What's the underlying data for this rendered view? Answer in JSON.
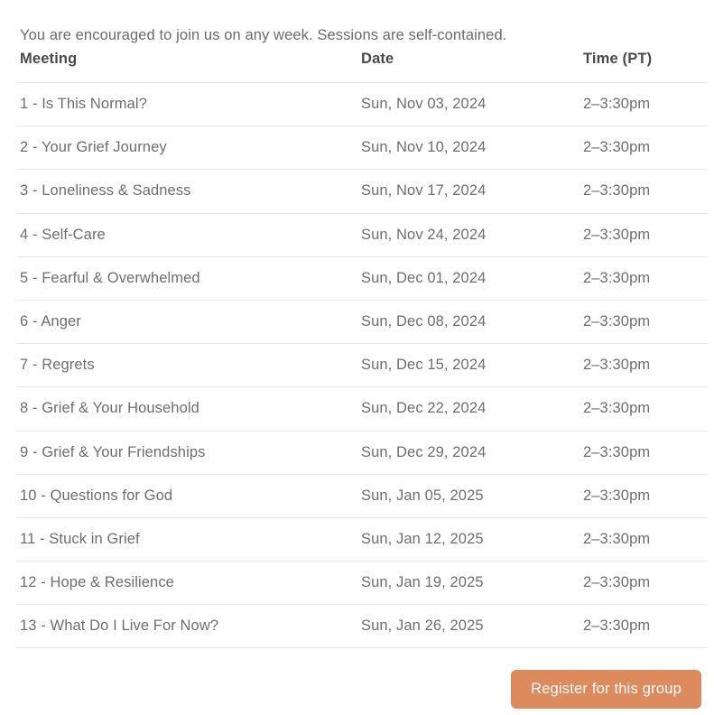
{
  "intro": {
    "text": "You are encouraged to join us on any week. Sessions are self-contained."
  },
  "table": {
    "columns": {
      "meeting": "Meeting",
      "date": "Date",
      "time": "Time (PT)"
    },
    "rows": [
      {
        "meeting": "1 - Is This Normal?",
        "date": "Sun, Nov 03, 2024",
        "time": "2–3:30pm"
      },
      {
        "meeting": "2 - Your Grief Journey",
        "date": "Sun, Nov 10, 2024",
        "time": "2–3:30pm"
      },
      {
        "meeting": "3 - Loneliness & Sadness",
        "date": "Sun, Nov 17, 2024",
        "time": "2–3:30pm"
      },
      {
        "meeting": "4 - Self-Care",
        "date": "Sun, Nov 24, 2024",
        "time": "2–3:30pm"
      },
      {
        "meeting": "5 - Fearful & Overwhelmed",
        "date": "Sun, Dec 01, 2024",
        "time": "2–3:30pm"
      },
      {
        "meeting": "6 - Anger",
        "date": "Sun, Dec 08, 2024",
        "time": "2–3:30pm"
      },
      {
        "meeting": "7 - Regrets",
        "date": "Sun, Dec 15, 2024",
        "time": "2–3:30pm"
      },
      {
        "meeting": "8 - Grief & Your Household",
        "date": "Sun, Dec 22, 2024",
        "time": "2–3:30pm"
      },
      {
        "meeting": "9 - Grief & Your Friendships",
        "date": "Sun, Dec 29, 2024",
        "time": "2–3:30pm"
      },
      {
        "meeting": "10 - Questions for God",
        "date": "Sun, Jan 05, 2025",
        "time": "2–3:30pm"
      },
      {
        "meeting": "11 - Stuck in Grief",
        "date": "Sun, Jan 12, 2025",
        "time": "2–3:30pm"
      },
      {
        "meeting": "12 - Hope & Resilience",
        "date": "Sun, Jan 19, 2025",
        "time": "2–3:30pm"
      },
      {
        "meeting": "13 - What Do I Live For Now?",
        "date": "Sun, Jan 26, 2025",
        "time": "2–3:30pm"
      }
    ]
  },
  "actions": {
    "register_label": "Register for this group"
  },
  "colors": {
    "accent": "#dd8a5c",
    "body_text": "#6e6e6e",
    "header_text": "#4a4a4a",
    "divider": "#e8e8e8",
    "background": "#ffffff"
  }
}
